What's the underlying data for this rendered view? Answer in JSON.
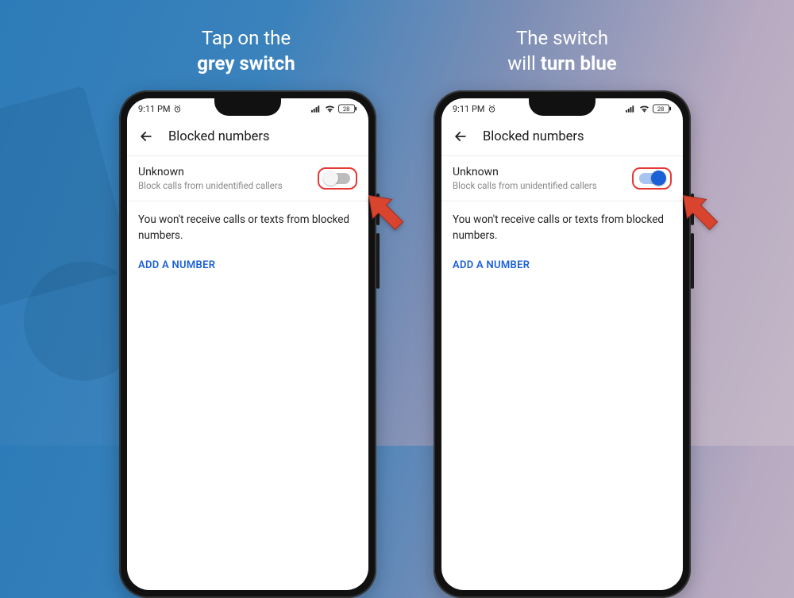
{
  "captions": {
    "left_line1": "Tap on the",
    "left_bold": "grey switch",
    "right_line1": "The switch",
    "right_line2a": "will ",
    "right_bold": "turn blue"
  },
  "statusbar": {
    "time": "9:11 PM",
    "battery": "28"
  },
  "appbar": {
    "title": "Blocked numbers"
  },
  "unknown_row": {
    "title": "Unknown",
    "subtitle": "Block calls from unidentified callers"
  },
  "info_text": "You won't receive calls or texts from blocked numbers.",
  "action_label": "ADD A NUMBER"
}
